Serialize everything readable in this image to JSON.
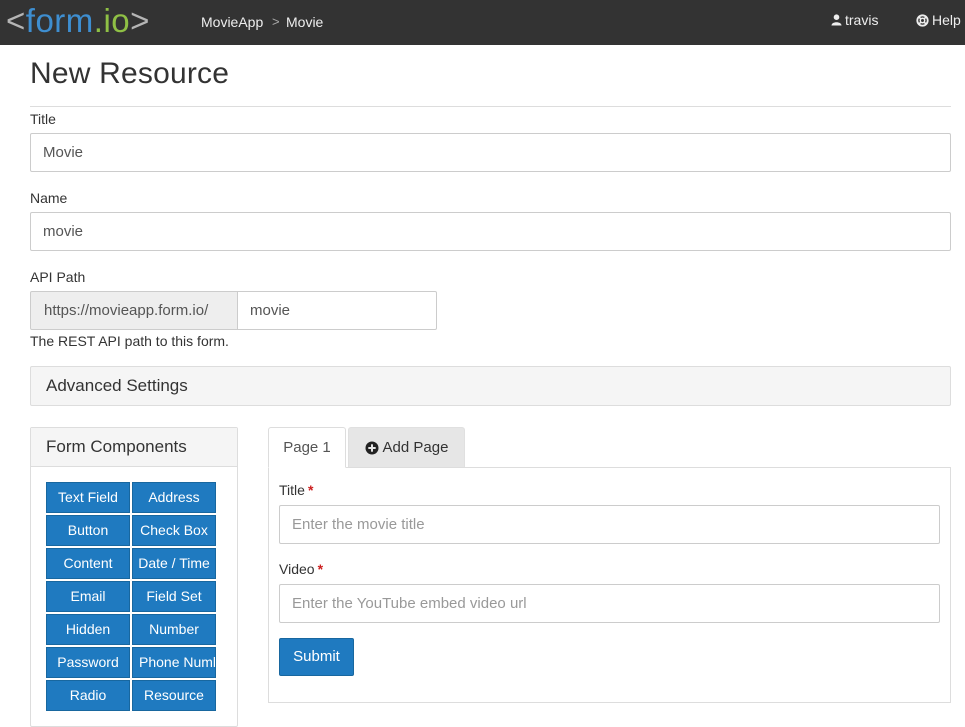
{
  "navbar": {
    "logo": {
      "open": "<",
      "form": "form",
      "dot": ".",
      "io": "io",
      "close": ">"
    },
    "breadcrumb": {
      "project": "MovieApp",
      "separator": ">",
      "current": "Movie"
    },
    "user": "travis",
    "help": "Help"
  },
  "page": {
    "title": "New Resource"
  },
  "fields": {
    "title": {
      "label": "Title",
      "value": "Movie"
    },
    "name": {
      "label": "Name",
      "value": "movie"
    },
    "api_path": {
      "label": "API Path",
      "prefix": "https://movieapp.form.io/",
      "value": "movie",
      "help": "The REST API path to this form."
    }
  },
  "advanced": {
    "label": "Advanced Settings"
  },
  "components": {
    "title": "Form Components",
    "items": [
      "Text Field",
      "Address",
      "Button",
      "Check Box",
      "Content",
      "Date / Time",
      "Email",
      "Field Set",
      "Hidden",
      "Number",
      "Password",
      "Phone Number",
      "Radio",
      "Resource"
    ]
  },
  "builder": {
    "tabs": {
      "page1": "Page 1",
      "add_page": "Add Page"
    },
    "form": {
      "title_label": "Title",
      "title_placeholder": "Enter the movie title",
      "video_label": "Video",
      "video_placeholder": "Enter the YouTube embed video url",
      "required_mark": "*",
      "submit": "Submit"
    }
  },
  "colors": {
    "navbar": "#333333",
    "primary": "#1f7ac0",
    "required": "#cc1e1e"
  }
}
